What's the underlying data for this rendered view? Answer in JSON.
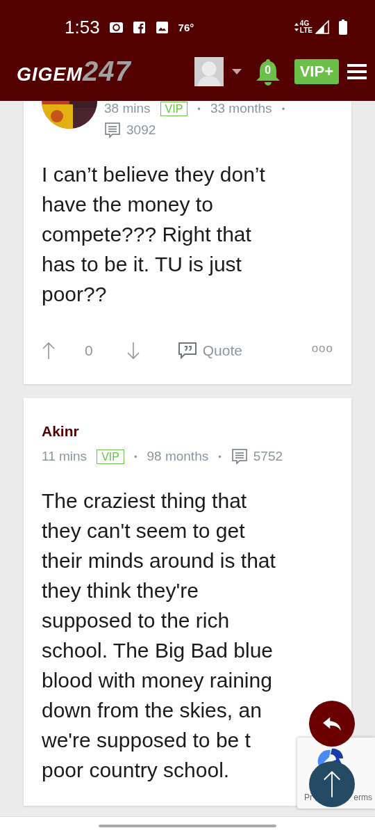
{
  "status_bar": {
    "time": "1:53",
    "temperature": "76°",
    "network": [
      "4G",
      "LTE"
    ]
  },
  "header": {
    "logo": [
      "GIGEM",
      "247"
    ],
    "notifications": "0",
    "vip_button": "VIP+"
  },
  "posts": [
    {
      "has_avatar": true,
      "separator": "•",
      "time": "38 mins",
      "badge": "VIP",
      "tenure": "33 months",
      "post_count": "3092",
      "lines": [
        "I can’t believe they don’t",
        "have the money to",
        "compete??? Right that",
        "has to be it. TU is just",
        "poor??"
      ],
      "actions": {
        "votes": "0",
        "quote": "Quote",
        "more": "ooo"
      }
    },
    {
      "author": "Akinr",
      "has_avatar": false,
      "separator": "•",
      "time": "11 mins",
      "badge": "VIP",
      "tenure": "98 months",
      "post_count": "5752",
      "lines": [
        "The craziest thing that",
        "they can't seem to get",
        "their minds around is that",
        "they think they're",
        "supposed to the rich",
        "school. The Big Bad blue",
        "blood with money raining",
        "down from the skies, an",
        "we're supposed to be t",
        "poor country school."
      ]
    }
  ],
  "recaptcha": {
    "left": "Pr",
    "right": "erms"
  }
}
